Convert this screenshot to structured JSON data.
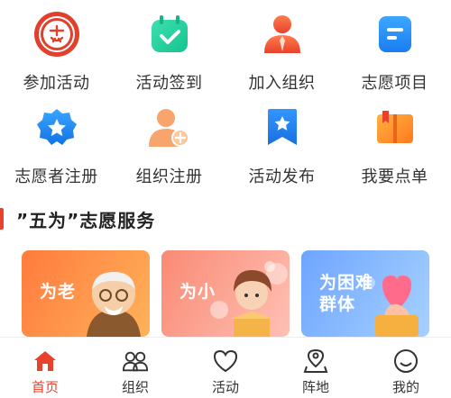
{
  "grid": {
    "row1": [
      {
        "label": "参加活动",
        "icon": "seal-icon"
      },
      {
        "label": "活动签到",
        "icon": "calendar-check-icon"
      },
      {
        "label": "加入组织",
        "icon": "person-tie-icon"
      },
      {
        "label": "志愿项目",
        "icon": "document-icon"
      }
    ],
    "row2": [
      {
        "label": "志愿者注册",
        "icon": "star-badge-icon"
      },
      {
        "label": "组织注册",
        "icon": "add-user-icon"
      },
      {
        "label": "活动发布",
        "icon": "bookmark-star-icon"
      },
      {
        "label": "我要点单",
        "icon": "book-icon"
      }
    ]
  },
  "section": {
    "title": "”五为”志愿服务"
  },
  "cards": [
    {
      "label": "为老"
    },
    {
      "label": "为小"
    },
    {
      "label_line1": "为困难",
      "label_line2": "群体"
    }
  ],
  "tabbar": [
    {
      "label": "首页",
      "icon": "home-icon",
      "active": true
    },
    {
      "label": "组织",
      "icon": "group-icon"
    },
    {
      "label": "活动",
      "icon": "heart-icon"
    },
    {
      "label": "阵地",
      "icon": "location-pin-icon"
    },
    {
      "label": "我的",
      "icon": "smile-icon"
    }
  ],
  "colors": {
    "accent": "#e8412c",
    "text": "#333333"
  }
}
